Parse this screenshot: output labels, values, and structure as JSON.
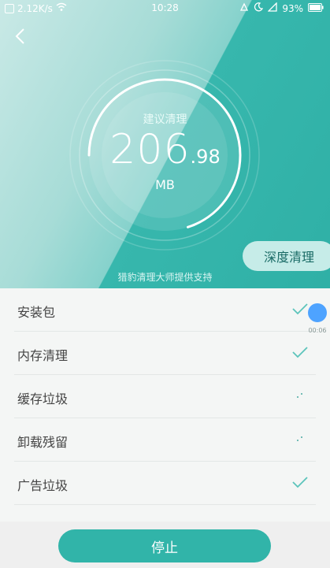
{
  "status_bar": {
    "network_speed": "2.12K/s",
    "time": "10:28",
    "battery": "93%"
  },
  "hero": {
    "suggest_label": "建议清理",
    "size_integer": "206",
    "size_decimal": ".98",
    "unit": "MB",
    "deep_clean_button": "深度清理",
    "support_text": "猎豹清理大师提供支持"
  },
  "progress": {
    "fraction": 0.7
  },
  "items": [
    {
      "label": "安装包",
      "status": "done"
    },
    {
      "label": "内存清理",
      "status": "done"
    },
    {
      "label": "缓存垃圾",
      "status": "loading"
    },
    {
      "label": "卸载残留",
      "status": "loading"
    },
    {
      "label": "广告垃圾",
      "status": "done"
    }
  ],
  "floating_timer": "00:06",
  "stop_button": "停止",
  "icons": {
    "back": "back-arrow-icon",
    "check": "check-icon",
    "loading": "loading-spinner-icon",
    "wifi": "wifi-icon",
    "battery": "battery-icon",
    "signal": "signal-icon"
  },
  "colors": {
    "accent": "#31b4a9",
    "hero_light": "#a7dcd7",
    "hero_dark": "#2fb0a6"
  }
}
